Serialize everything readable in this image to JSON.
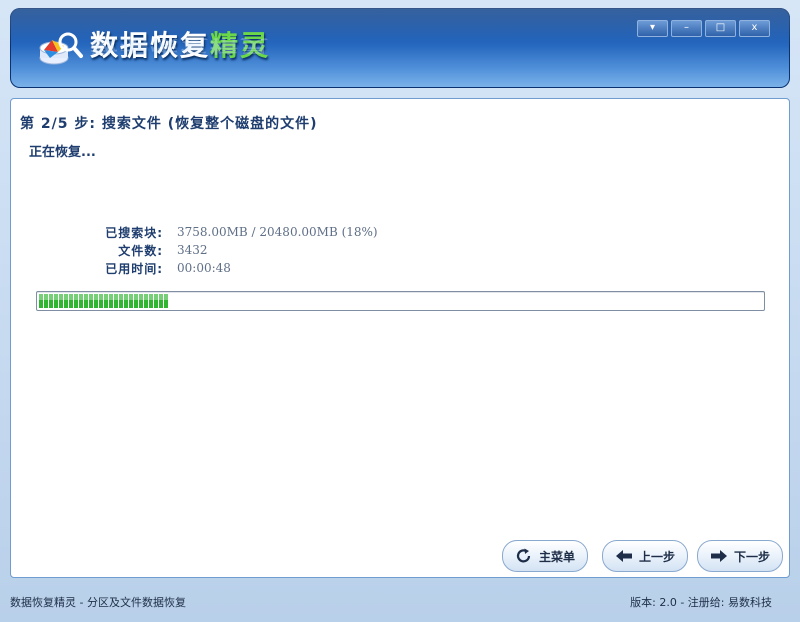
{
  "app": {
    "title_main": "数据恢复",
    "title_accent": "精灵"
  },
  "window_controls": {
    "menu": "▾",
    "minimize": "–",
    "maximize": "□",
    "close": "x"
  },
  "main": {
    "step_title": "第 2/5 步: 搜索文件 (恢复整个磁盘的文件)",
    "status": "正在恢复...",
    "info": [
      {
        "label": "已搜索块:",
        "value": "3758.00MB / 20480.00MB (18%)"
      },
      {
        "label": "文件数:",
        "value": "3432"
      },
      {
        "label": "已用时间:",
        "value": "00:00:48"
      }
    ],
    "progress_percent": 18
  },
  "buttons": {
    "main_menu": "主菜单",
    "prev": "上一步",
    "next": "下一步"
  },
  "statusbar": {
    "left": "数据恢复精灵 - 分区及文件数据恢复",
    "right": "版本: 2.0 - 注册给: 易数科技"
  },
  "icons": {
    "logo": "database-magnifier-icon",
    "main_menu": "refresh-icon",
    "prev": "arrow-left-icon",
    "next": "arrow-right-icon"
  },
  "colors": {
    "progress": "#2fb52f",
    "banner": "#1d5fb8",
    "title_accent": "#6bd84a"
  }
}
